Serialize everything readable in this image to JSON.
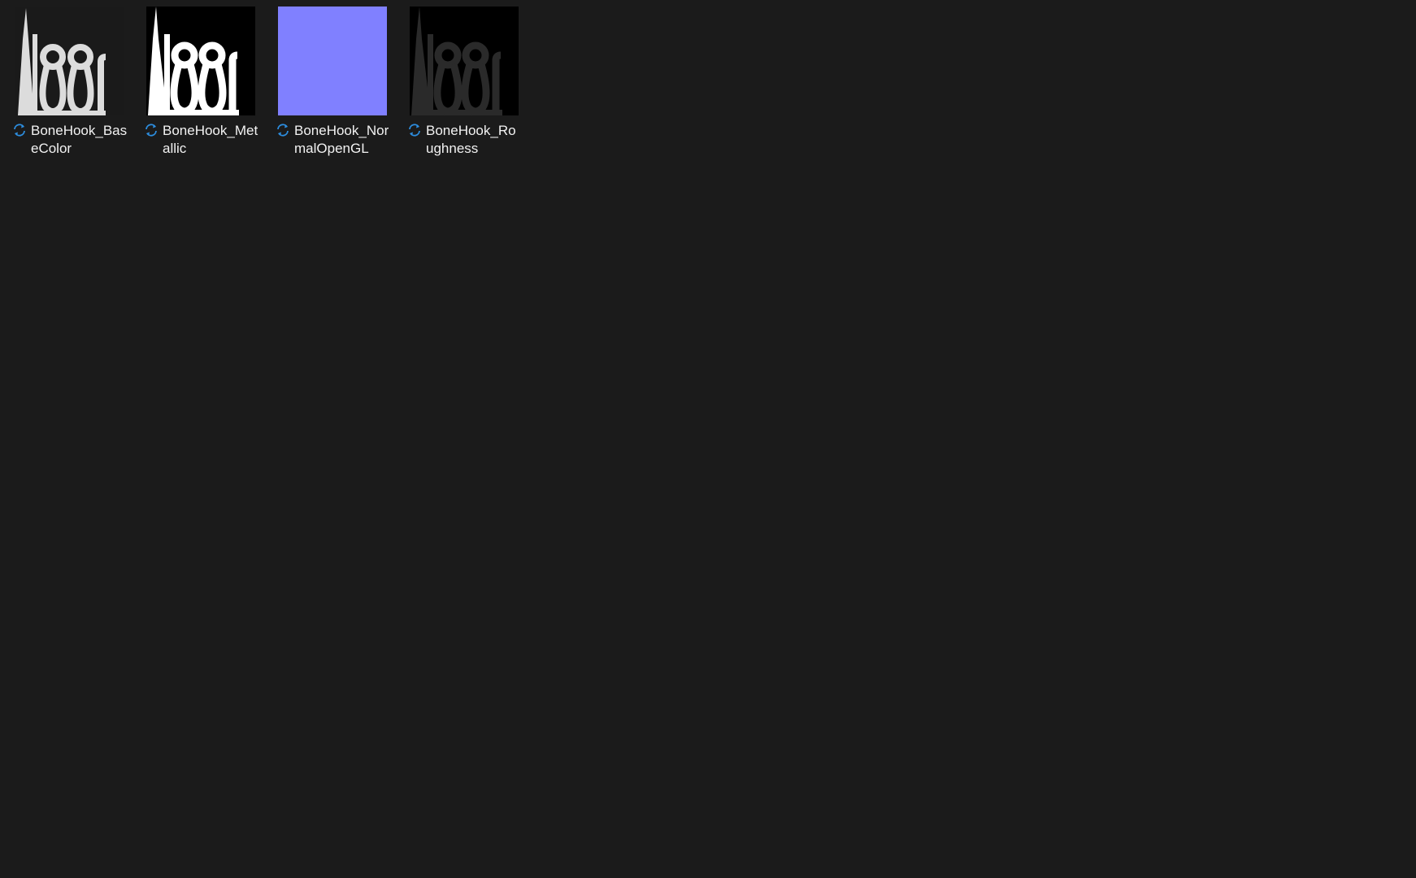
{
  "view": {
    "background": "#1b1b1b",
    "files": [
      {
        "name": "BoneHook_BaseColor",
        "status_icon": "sync-icon",
        "thumbnail": {
          "kind": "bone-hook-texture",
          "background": "#1a1a1a",
          "foreground": "#dcdcdc"
        }
      },
      {
        "name": "BoneHook_Metallic",
        "status_icon": "sync-icon",
        "thumbnail": {
          "kind": "bone-hook-texture",
          "background": "#000000",
          "foreground": "#ffffff"
        }
      },
      {
        "name": "BoneHook_NormalOpenGL",
        "status_icon": "sync-icon",
        "thumbnail": {
          "kind": "solid",
          "background": "#8080ff"
        }
      },
      {
        "name": "BoneHook_Roughness",
        "status_icon": "sync-icon",
        "thumbnail": {
          "kind": "bone-hook-texture",
          "background": "#000000",
          "foreground": "#2a2a2a"
        }
      }
    ],
    "accent_color": "#2d8ee0"
  }
}
